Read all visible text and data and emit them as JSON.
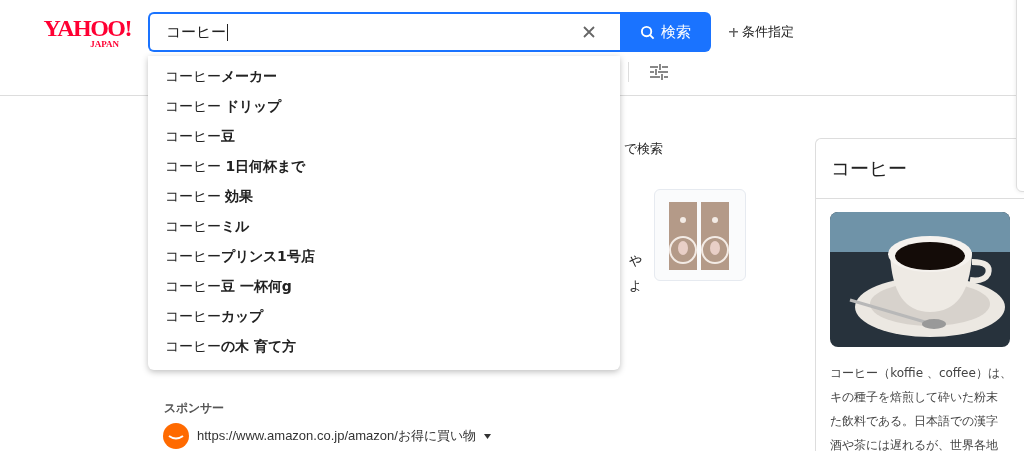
{
  "logo": {
    "main": "YAHOO!",
    "sub": "JAPAN"
  },
  "search": {
    "value": "コーヒー",
    "button": "検索"
  },
  "advanced_link": "条件指定",
  "suggestions": [
    "コーヒー**メーカー**",
    "コーヒー **ドリップ**",
    "コーヒー**豆**",
    "コーヒー **1日何杯まで**",
    "コーヒー **効果**",
    "コーヒー**ミル**",
    "コーヒー**プリンス1号店**",
    "コーヒー**豆 一杯何g**",
    "コーヒー**カップ**",
    "コーヒー**の木 育て方**"
  ],
  "hidden_fragments": [
    "で検索",
    "や",
    "よ"
  ],
  "sponsor": {
    "label": "スポンサー",
    "url": "https://www.amazon.co.jp/amazon/お得に買い物"
  },
  "knowledge_card": {
    "title": "コーヒー",
    "lines": [
      "コーヒー（koffie 、coffee）は、",
      "キの種子を焙煎して砕いた粉末",
      "た飲料である。日本語での漢字",
      "酒や茶には遅れるが、世界各地"
    ]
  }
}
